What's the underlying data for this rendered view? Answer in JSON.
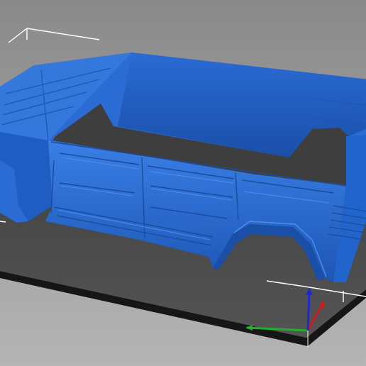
{
  "viewport": {
    "kind": "3d-print-slicer-view",
    "background_top": "#8a8a8a",
    "background_bottom": "#b4b4b4",
    "build_plate_color": "#4a4a4a",
    "build_plate_edge_color": "#161616",
    "bounding_volume_line_color": "#ffffff"
  },
  "model": {
    "name": "vehicle-body-shell",
    "color": "#2a6bd4",
    "shade_dark": "#1d56b4",
    "shade_light": "#3a7fe6"
  },
  "axes_gizmo": {
    "x_axis_color": "#d01a1a",
    "y_axis_color": "#22b02a",
    "z_axis_color": "#1a2ad0"
  }
}
